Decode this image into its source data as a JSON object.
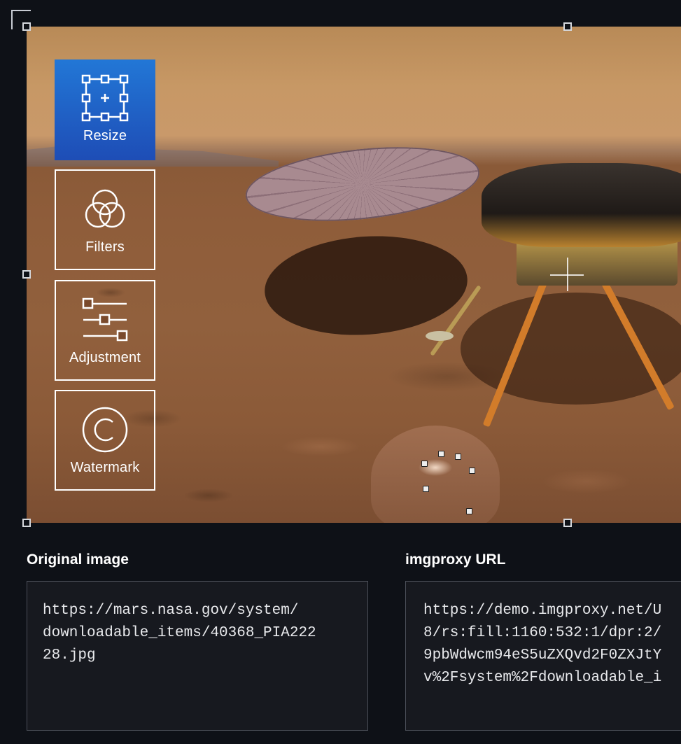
{
  "tools": [
    {
      "label": "Resize",
      "icon": "resize-icon",
      "active": true
    },
    {
      "label": "Filters",
      "icon": "filters-icon",
      "active": false
    },
    {
      "label": "Adjustment",
      "icon": "adjustment-icon",
      "active": false
    },
    {
      "label": "Watermark",
      "icon": "watermark-icon",
      "active": false
    }
  ],
  "original": {
    "title": "Original image",
    "lines": [
      "https://mars.nasa.gov/system/",
      "downloadable_items/40368_PIA222",
      "28.jpg"
    ]
  },
  "imgproxy": {
    "title": "imgproxy URL",
    "lines": [
      "https://demo.imgproxy.net/U",
      "8/rs:fill:1160:532:1/dpr:2/",
      "9pbWdwcm94eS5uZXQvd2F0ZXJtY",
      "v%2Fsystem%2Fdownloadable_i"
    ]
  },
  "colors": {
    "background": "#0e1117",
    "active_tool": "#1e63cc",
    "box_border": "#4b4f58"
  }
}
